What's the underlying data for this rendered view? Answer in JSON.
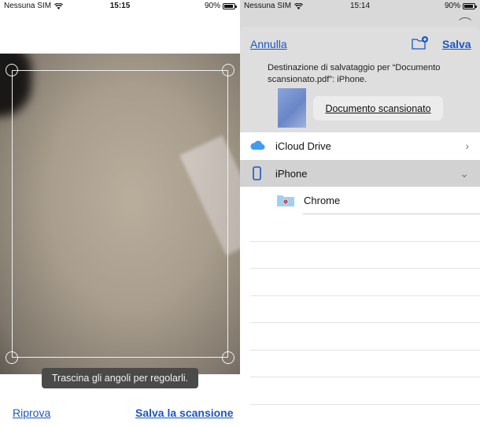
{
  "left_screen": {
    "status_bar": {
      "carrier": "Nessuna SIM",
      "time": "15:15",
      "battery": "90%",
      "battery_level": 0.9
    },
    "tooltip": "Trascina gli angoli per regolarli.",
    "retake_label": "Riprova",
    "save_scan_label": "Salva la scansione",
    "accent_color": "#1a56c4"
  },
  "right_screen": {
    "status_bar": {
      "carrier": "Nessuna SIM",
      "time": "15:14",
      "battery": "90%",
      "battery_level": 0.9
    },
    "cancel_label": "Annulla",
    "save_label": "Salva",
    "new_folder_icon": "folder-add-icon",
    "destination_text": "Destinazione di salvataggio per “Documento scansionato.pdf”: iPhone.",
    "file_name": "Documento scansionato",
    "locations": [
      {
        "label": "iCloud Drive",
        "icon": "icloud-icon",
        "indicator": "›",
        "selected": false
      },
      {
        "label": "iPhone",
        "icon": "iphone-icon",
        "indicator": "⌄",
        "selected": true
      }
    ],
    "folders": [
      {
        "label": "Chrome",
        "icon": "chrome-folder-icon"
      }
    ]
  }
}
